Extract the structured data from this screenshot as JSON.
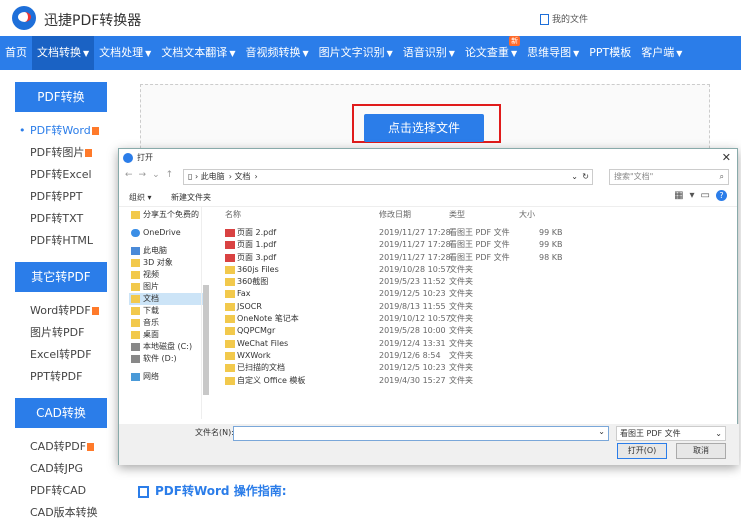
{
  "brand": {
    "name": "迅捷PDF转换器",
    "my_files": "我的文件"
  },
  "nav": {
    "items": [
      {
        "label": "首页",
        "caret": false
      },
      {
        "label": "文档转换",
        "caret": true,
        "active": true
      },
      {
        "label": "文档处理",
        "caret": true
      },
      {
        "label": "文档文本翻译",
        "caret": true
      },
      {
        "label": "音视频转换",
        "caret": true
      },
      {
        "label": "图片文字识别",
        "caret": true
      },
      {
        "label": "语音识别",
        "caret": true
      },
      {
        "label": "论文查重",
        "caret": true,
        "badge": "新"
      },
      {
        "label": "思维导图",
        "caret": true
      },
      {
        "label": "PPT模板",
        "caret": false
      },
      {
        "label": "客户端",
        "caret": true
      }
    ]
  },
  "sidebar": {
    "sections": [
      {
        "title": "PDF转换",
        "items": [
          {
            "label": "PDF转Word",
            "active": true,
            "hot": true
          },
          {
            "label": "PDF转图片",
            "hot": true
          },
          {
            "label": "PDF转Excel"
          },
          {
            "label": "PDF转PPT"
          },
          {
            "label": "PDF转TXT"
          },
          {
            "label": "PDF转HTML"
          }
        ]
      },
      {
        "title": "其它转PDF",
        "items": [
          {
            "label": "Word转PDF",
            "hot": true
          },
          {
            "label": "图片转PDF"
          },
          {
            "label": "Excel转PDF"
          },
          {
            "label": "PPT转PDF"
          }
        ]
      },
      {
        "title": "CAD转换",
        "items": [
          {
            "label": "CAD转PDF",
            "hot": true
          },
          {
            "label": "CAD转JPG"
          },
          {
            "label": "PDF转CAD"
          },
          {
            "label": "CAD版本转换"
          }
        ]
      }
    ]
  },
  "main": {
    "upload_button": "点击选择文件",
    "guide_title": "PDF转Word 操作指南:"
  },
  "dialog": {
    "title": "打开",
    "address": [
      "此电脑",
      "文档"
    ],
    "search_placeholder": "搜索\"文档\"",
    "organize": "组织 ▾",
    "new_folder": "新建文件夹",
    "tree": [
      {
        "label": "分享五个免费的",
        "icon": "folder"
      },
      {
        "label": "",
        "icon": "gap"
      },
      {
        "label": "OneDrive",
        "icon": "cloud"
      },
      {
        "label": "",
        "icon": "gap"
      },
      {
        "label": "此电脑",
        "icon": "pc"
      },
      {
        "label": "3D 对象",
        "icon": "folder"
      },
      {
        "label": "视频",
        "icon": "folder"
      },
      {
        "label": "图片",
        "icon": "folder"
      },
      {
        "label": "文档",
        "icon": "folder",
        "selected": true
      },
      {
        "label": "下载",
        "icon": "folder"
      },
      {
        "label": "音乐",
        "icon": "folder"
      },
      {
        "label": "桌面",
        "icon": "folder"
      },
      {
        "label": "本地磁盘 (C:)",
        "icon": "drive"
      },
      {
        "label": "软件 (D:)",
        "icon": "drive"
      },
      {
        "label": "",
        "icon": "gap"
      },
      {
        "label": "网络",
        "icon": "net"
      }
    ],
    "columns": {
      "name": "名称",
      "date": "修改日期",
      "type": "类型",
      "size": "大小"
    },
    "files": [
      {
        "name": "页面 2.pdf",
        "date": "2019/11/27 17:28",
        "type": "看图王 PDF 文件",
        "size": "99 KB",
        "pdf": true
      },
      {
        "name": "页面 1.pdf",
        "date": "2019/11/27 17:28",
        "type": "看图王 PDF 文件",
        "size": "99 KB",
        "pdf": true
      },
      {
        "name": "页面 3.pdf",
        "date": "2019/11/27 17:28",
        "type": "看图王 PDF 文件",
        "size": "98 KB",
        "pdf": true
      },
      {
        "name": "360js Files",
        "date": "2019/10/28 10:57",
        "type": "文件夹",
        "size": ""
      },
      {
        "name": "360截图",
        "date": "2019/5/23 11:52",
        "type": "文件夹",
        "size": ""
      },
      {
        "name": "Fax",
        "date": "2019/12/5 10:23",
        "type": "文件夹",
        "size": ""
      },
      {
        "name": "JSOCR",
        "date": "2019/8/13 11:55",
        "type": "文件夹",
        "size": ""
      },
      {
        "name": "OneNote 笔记本",
        "date": "2019/10/12 10:57",
        "type": "文件夹",
        "size": ""
      },
      {
        "name": "QQPCMgr",
        "date": "2019/5/28 10:00",
        "type": "文件夹",
        "size": ""
      },
      {
        "name": "WeChat Files",
        "date": "2019/12/4 13:31",
        "type": "文件夹",
        "size": ""
      },
      {
        "name": "WXWork",
        "date": "2019/12/6 8:54",
        "type": "文件夹",
        "size": ""
      },
      {
        "name": "已扫描的文档",
        "date": "2019/12/5 10:23",
        "type": "文件夹",
        "size": ""
      },
      {
        "name": "自定义 Office 模板",
        "date": "2019/4/30 15:27",
        "type": "文件夹",
        "size": ""
      }
    ],
    "filename_label": "文件名(N):",
    "filename_value": "",
    "filetype": "看图王 PDF 文件",
    "open_button": "打开(O)",
    "cancel_button": "取消"
  }
}
